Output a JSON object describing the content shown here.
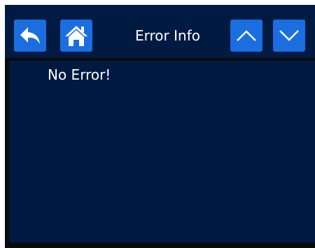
{
  "header": {
    "title": "Error Info",
    "back_button": {
      "icon": "back-arrow-icon"
    },
    "home_button": {
      "icon": "home-icon"
    },
    "scroll_up_button": {
      "icon": "chevron-up-icon"
    },
    "scroll_down_button": {
      "icon": "chevron-down-icon"
    }
  },
  "content": {
    "message": "No Error!"
  },
  "colors": {
    "background": "#001a42",
    "button": "#1a6ee0",
    "text": "#ffffff",
    "frame": "#0a0a0a"
  }
}
